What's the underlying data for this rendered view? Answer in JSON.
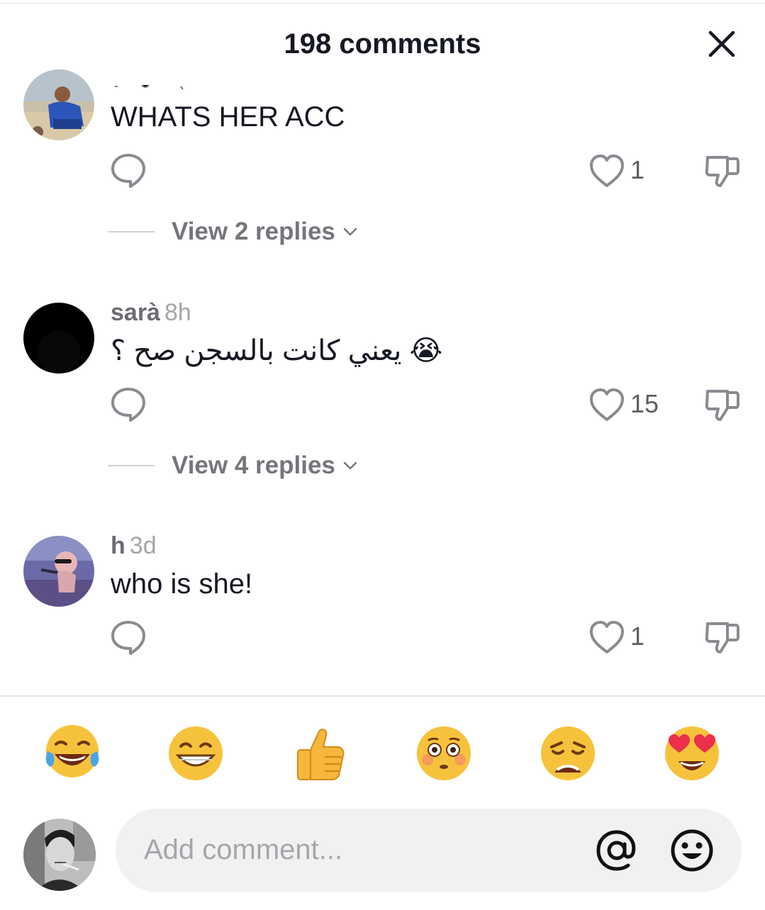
{
  "header": {
    "title": "198 comments"
  },
  "comments": [
    {
      "text": "WHATS HER ACC",
      "likes": "1",
      "view_replies": "View 2 replies"
    },
    {
      "username": "sarà",
      "time": "8h",
      "text": "يعني كانت بالسجن صح ؟ 😭",
      "likes": "15",
      "view_replies": "View 4 replies"
    },
    {
      "username": "h",
      "time": "3d",
      "text": "who is she!",
      "likes": "1"
    }
  ],
  "quick_emojis": [
    "joy",
    "grin",
    "thumbs-up",
    "flushed",
    "weary",
    "heart-eyes"
  ],
  "composer": {
    "placeholder": "Add comment..."
  },
  "icons": {
    "close": "close-icon",
    "reply": "speech-bubble-icon",
    "like": "heart-outline-icon",
    "dislike": "thumbs-down-icon",
    "mention": "at-sign-icon",
    "emoji": "smiley-icon"
  }
}
